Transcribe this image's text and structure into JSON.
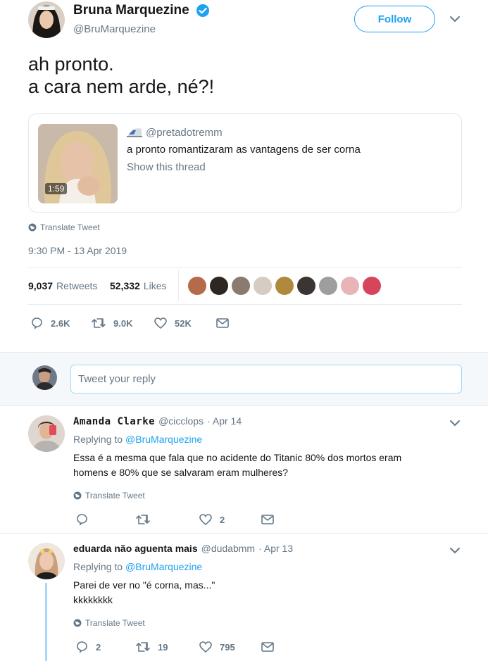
{
  "tweet": {
    "author_name": "Bruna Marquezine",
    "author_handle": "@BruMarquezine",
    "follow_label": "Follow",
    "text_line1": "ah pronto.",
    "text_line2": "a cara nem arde, né?!",
    "quote": {
      "handle": "@pretadotremm",
      "text": "a pronto romantizaram as vantagens de ser corna",
      "show_thread": "Show this thread",
      "duration": "1:59"
    },
    "translate": "Translate Tweet",
    "timestamp": "9:30 PM - 13 Apr 2019",
    "retweets_count": "9,037",
    "retweets_label": "Retweets",
    "likes_count": "52,332",
    "likes_label": "Likes",
    "actions": {
      "replies": "2.6K",
      "retweets": "9.0K",
      "likes": "52K"
    }
  },
  "reply_box": {
    "placeholder": "Tweet your reply"
  },
  "replies": [
    {
      "name": "Amanda Clarke",
      "handle": "@cicclops",
      "date": "· Apr 14",
      "replying_prefix": "Replying to",
      "replying_to": "@BruMarquezine",
      "text_line1": "Essa é a mesma que fala que no acidente do Titanic 80% dos mortos eram",
      "text_line2": "homens e 80% que se salvaram eram mulheres?",
      "translate": "Translate Tweet",
      "replies": "",
      "retweets": "",
      "likes": "2"
    },
    {
      "name": "eduarda não aguenta mais",
      "handle": "@dudabmm",
      "date": "· Apr 13",
      "replying_prefix": "Replying to",
      "replying_to": "@BruMarquezine",
      "text_line1": "Parei de ver no \"é corna, mas...\"",
      "text_line2": "kkkkkkkk",
      "translate": "Translate Tweet",
      "replies": "2",
      "retweets": "19",
      "likes": "795"
    }
  ],
  "colors": {
    "accent": "#1da1f2",
    "muted": "#657786",
    "border": "#e6ecf0",
    "verified": "#1da1f2"
  }
}
